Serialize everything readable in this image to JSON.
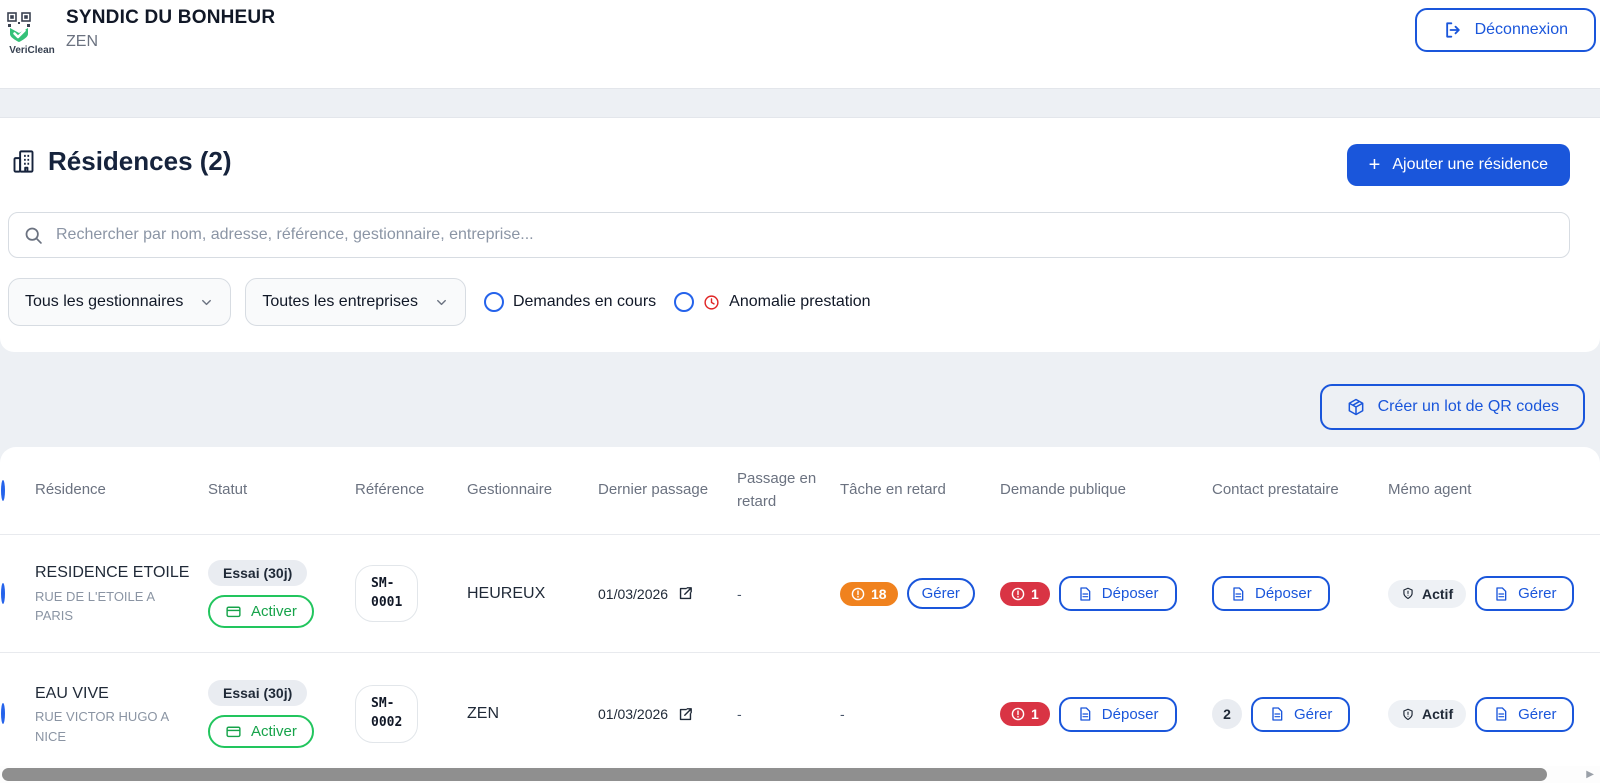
{
  "brand": {
    "name": "VeriClean"
  },
  "header": {
    "title": "SYNDIC DU BONHEUR",
    "subtitle": "ZEN",
    "logout_label": "Déconnexion"
  },
  "main": {
    "heading": "Résidences (2)",
    "add_residence_label": "Ajouter une résidence",
    "search_placeholder": "Rechercher par nom, adresse, référence, gestionnaire, entreprise...",
    "filter_managers": "Tous les gestionnaires",
    "filter_companies": "Toutes les entreprises",
    "filter_requests": "Demandes en cours",
    "filter_anomaly": "Anomalie prestation",
    "qr_batch_label": "Créer un lot de QR codes"
  },
  "table": {
    "headers": [
      "Résidence",
      "Statut",
      "Référence",
      "Gestionnaire",
      "Dernier passage",
      "Passage en retard",
      "Tâche en retard",
      "Demande publique",
      "Contact prestataire",
      "Mémo agent"
    ],
    "rows": [
      {
        "name": "RESIDENCE ETOILE",
        "address": "RUE DE L'ETOILE A PARIS",
        "status": "Essai (30j)",
        "activate_label": "Activer",
        "ref_line1": "SM-",
        "ref_line2": "0001",
        "manager": "HEUREUX",
        "last_visit": "01/03/2026",
        "late_visit": "-",
        "late_tasks_count": "18",
        "late_tasks_action": "Gérer",
        "public_request_count": "1",
        "public_request_action": "Déposer",
        "contact_action": "Déposer",
        "memo_status": "Actif",
        "memo_action": "Gérer"
      },
      {
        "name": "EAU VIVE",
        "address": "RUE VICTOR HUGO A NICE",
        "status": "Essai (30j)",
        "activate_label": "Activer",
        "ref_line1": "SM-",
        "ref_line2": "0002",
        "manager": "ZEN",
        "last_visit": "01/03/2026",
        "late_visit": "-",
        "late_tasks": "-",
        "public_request_count": "1",
        "public_request_action": "Déposer",
        "contact_count": "2",
        "contact_action": "Gérer",
        "memo_status": "Actif",
        "memo_action": "Gérer"
      }
    ]
  },
  "colors": {
    "accent_blue": "#1a56db",
    "orange_alert": "#f0821e",
    "red_alert": "#d93444",
    "green_activate": "#22c55e",
    "page_background": "#edf0f4"
  }
}
